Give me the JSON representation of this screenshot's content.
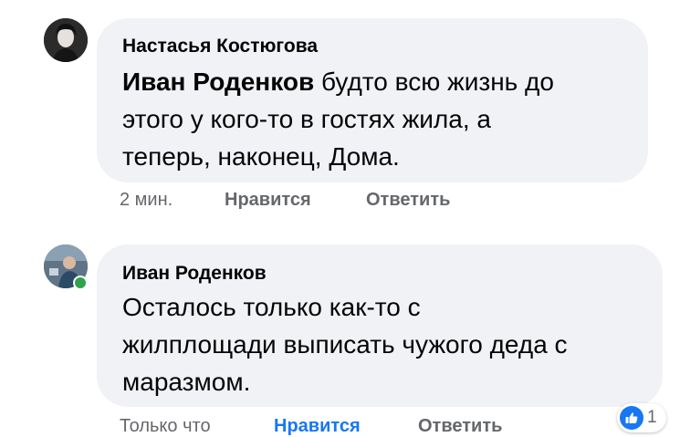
{
  "comments": [
    {
      "author": "Настасья Костюгова",
      "mention": "Иван Роденков",
      "text": " будто всю жизнь до\nэтого у кого-то в гостях жила, а\nтеперь, наконец, Дома.",
      "time": "2 мин.",
      "like_label": "Нравится",
      "reply_label": "Ответить"
    },
    {
      "author": "Иван Роденков",
      "text": "Осталось только как-то с\nжилплощади выписать чужого деда с\nмаразмом.",
      "time": "Только что",
      "like_label": "Нравится",
      "reply_label": "Ответить",
      "liked": true,
      "reaction": {
        "icon": "thumbs-up-icon",
        "count": "1"
      }
    }
  ],
  "colors": {
    "bubble": "#f0f2f5",
    "link": "#1877f2",
    "muted": "#65676b",
    "online": "#31a24c"
  }
}
